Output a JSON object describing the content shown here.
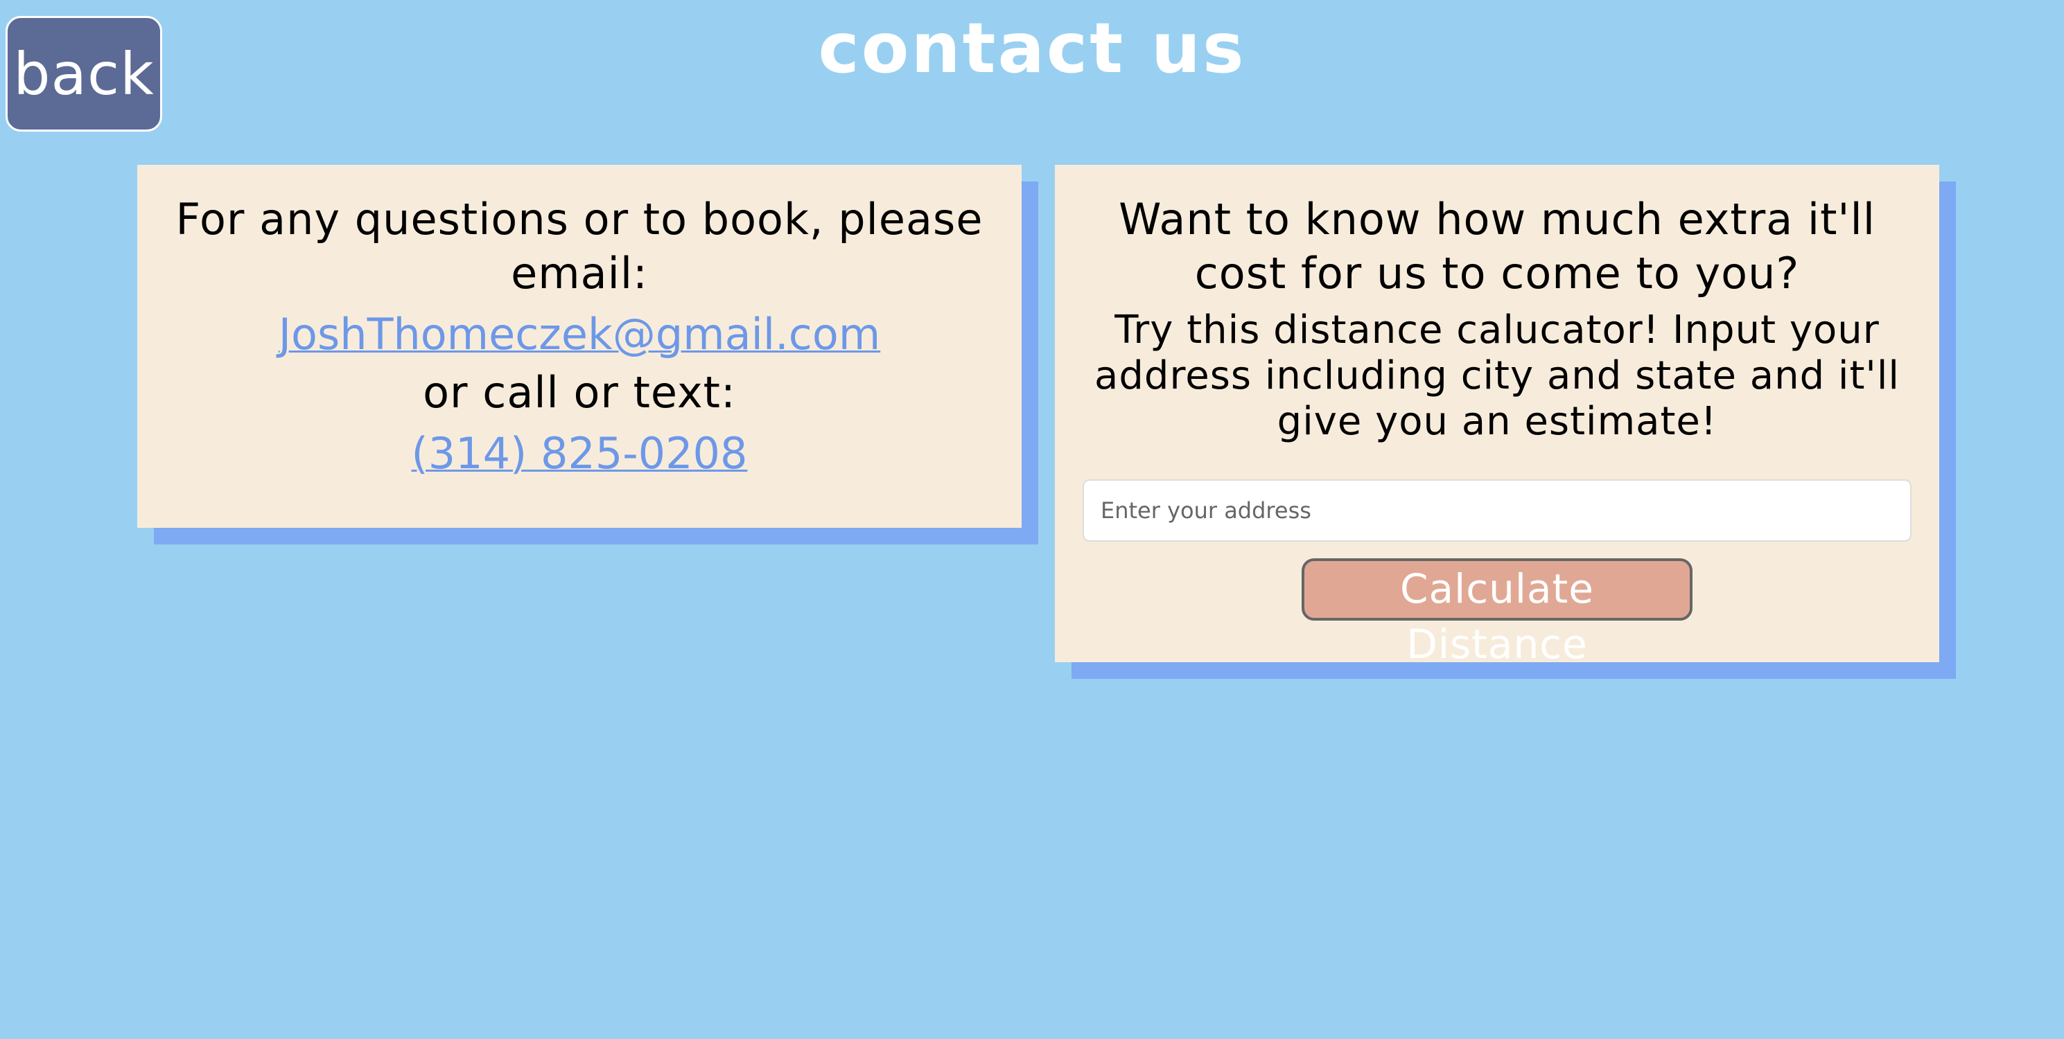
{
  "header": {
    "back_label": "back",
    "title": "contact us"
  },
  "contact_card": {
    "intro": "For any questions or to book, please email:",
    "email": "JoshThomeczek@gmail.com",
    "call_text": "or call or text:",
    "phone": "(314) 825-0208"
  },
  "distance_card": {
    "heading": "Want to know how much extra it'll cost for us to come to you?",
    "instructions": "Try this distance calucator! Input your address including city and state and it'll give you an estimate!",
    "address_placeholder": "Enter your address",
    "address_value": "",
    "button_label": "Calculate Distance"
  },
  "colors": {
    "background": "#99d0f2",
    "card": "#f7ecdb",
    "card_shadow": "#7ea9f3",
    "back_button": "#5c6a96",
    "link": "#6d98e8",
    "calc_button": "#e0a894"
  }
}
